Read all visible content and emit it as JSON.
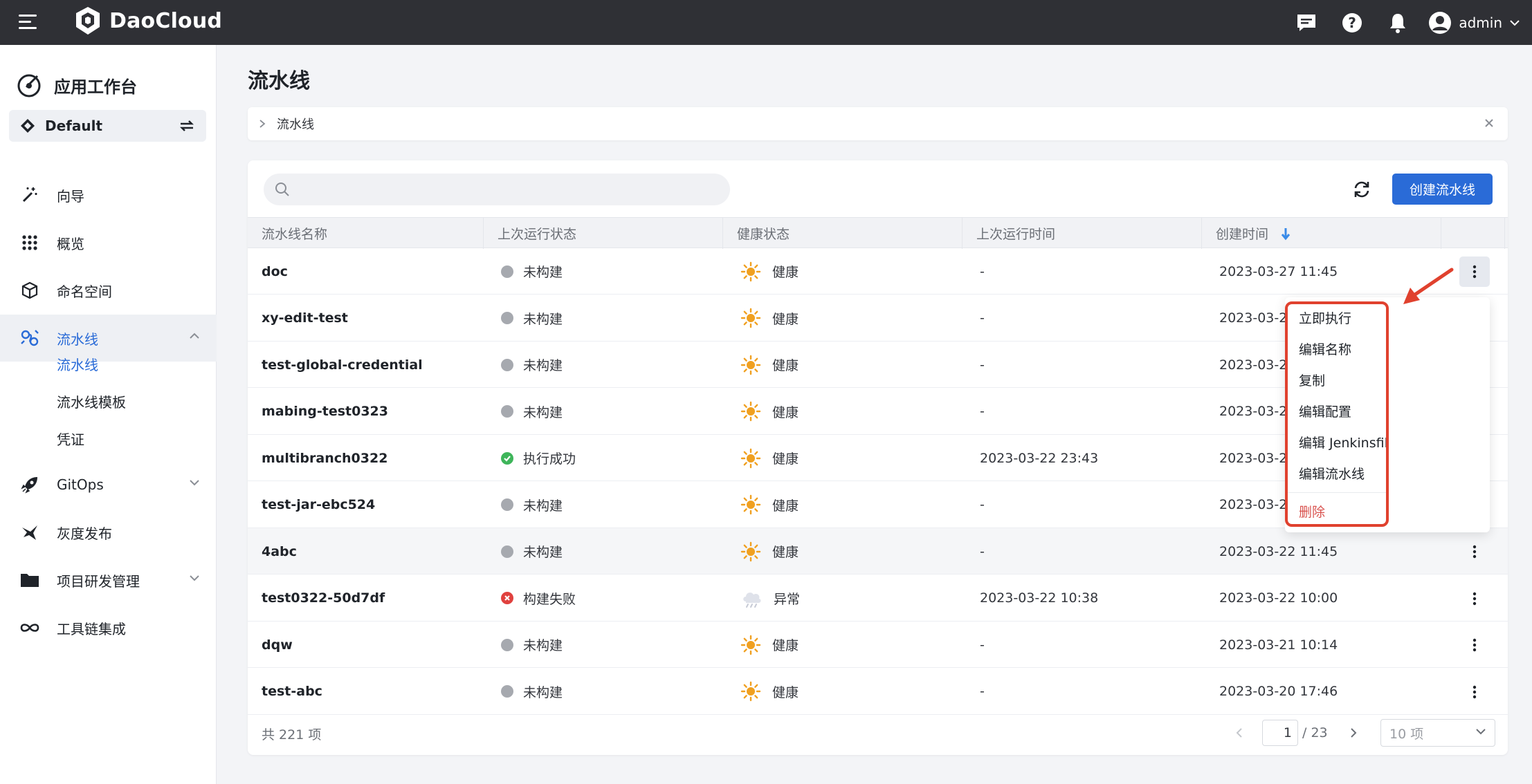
{
  "topbar": {
    "brand": "DaoCloud",
    "user": "admin",
    "icons": [
      "message-icon",
      "help-icon",
      "bell-icon",
      "user-avatar-icon"
    ]
  },
  "sidebar": {
    "title": "应用工作台",
    "workspace": "Default",
    "nav": [
      {
        "label": "向导",
        "icon": "magic-wand-icon"
      },
      {
        "label": "概览",
        "icon": "grid-icon"
      },
      {
        "label": "命名空间",
        "icon": "cube-icon"
      },
      {
        "label": "流水线",
        "icon": "pipeline-icon",
        "active": true,
        "expanded": true
      },
      {
        "label": "GitOps",
        "icon": "rocket-icon"
      },
      {
        "label": "灰度发布",
        "icon": "bird-icon"
      },
      {
        "label": "项目研发管理",
        "icon": "folder-icon"
      },
      {
        "label": "工具链集成",
        "icon": "infinity-icon"
      }
    ],
    "sub": [
      "流水线",
      "流水线模板",
      "凭证"
    ]
  },
  "page": {
    "title": "流水线",
    "breadcrumb": "流水线",
    "search_placeholder": "",
    "create_label": "创建流水线"
  },
  "table": {
    "columns": [
      "流水线名称",
      "上次运行状态",
      "健康状态",
      "上次运行时间",
      "创建时间"
    ],
    "rows": [
      {
        "name": "doc",
        "status": "未构建",
        "status_type": "none",
        "health": "健康",
        "health_type": "sunny",
        "last_run": "-",
        "created": "2023-03-27 11:45"
      },
      {
        "name": "xy-edit-test",
        "status": "未构建",
        "status_type": "none",
        "health": "健康",
        "health_type": "sunny",
        "last_run": "-",
        "created": "2023-03-2"
      },
      {
        "name": "test-global-credential",
        "status": "未构建",
        "status_type": "none",
        "health": "健康",
        "health_type": "sunny",
        "last_run": "-",
        "created": "2023-03-2"
      },
      {
        "name": "mabing-test0323",
        "status": "未构建",
        "status_type": "none",
        "health": "健康",
        "health_type": "sunny",
        "last_run": "-",
        "created": "2023-03-2"
      },
      {
        "name": "multibranch0322",
        "status": "执行成功",
        "status_type": "success",
        "health": "健康",
        "health_type": "sunny",
        "last_run": "2023-03-22 23:43",
        "created": "2023-03-2"
      },
      {
        "name": "test-jar-ebc524",
        "status": "未构建",
        "status_type": "none",
        "health": "健康",
        "health_type": "sunny",
        "last_run": "-",
        "created": "2023-03-2"
      },
      {
        "name": "4abc",
        "status": "未构建",
        "status_type": "none",
        "health": "健康",
        "health_type": "sunny",
        "last_run": "-",
        "created": "2023-03-22 11:45"
      },
      {
        "name": "test0322-50d7df",
        "status": "构建失败",
        "status_type": "failed",
        "health": "异常",
        "health_type": "cloudy",
        "last_run": "2023-03-22 10:38",
        "created": "2023-03-22 10:00"
      },
      {
        "name": "dqw",
        "status": "未构建",
        "status_type": "none",
        "health": "健康",
        "health_type": "sunny",
        "last_run": "-",
        "created": "2023-03-21 10:14"
      },
      {
        "name": "test-abc",
        "status": "未构建",
        "status_type": "none",
        "health": "健康",
        "health_type": "sunny",
        "last_run": "-",
        "created": "2023-03-20 17:46"
      }
    ]
  },
  "footer": {
    "total": "共 221 项",
    "page": "1",
    "page_total": "/ 23",
    "page_size": "10 项"
  },
  "menu": {
    "items": [
      "立即执行",
      "编辑名称",
      "复制",
      "编辑配置",
      "编辑 Jenkinsfile",
      "编辑流水线"
    ],
    "danger": "删除"
  },
  "colors": {
    "accent": "#2a6bd7",
    "topbar": "#2f3035",
    "highlight": "#e0412e",
    "sunny": "#f0a020",
    "success": "#3eb55a",
    "failed": "#e0413e"
  }
}
